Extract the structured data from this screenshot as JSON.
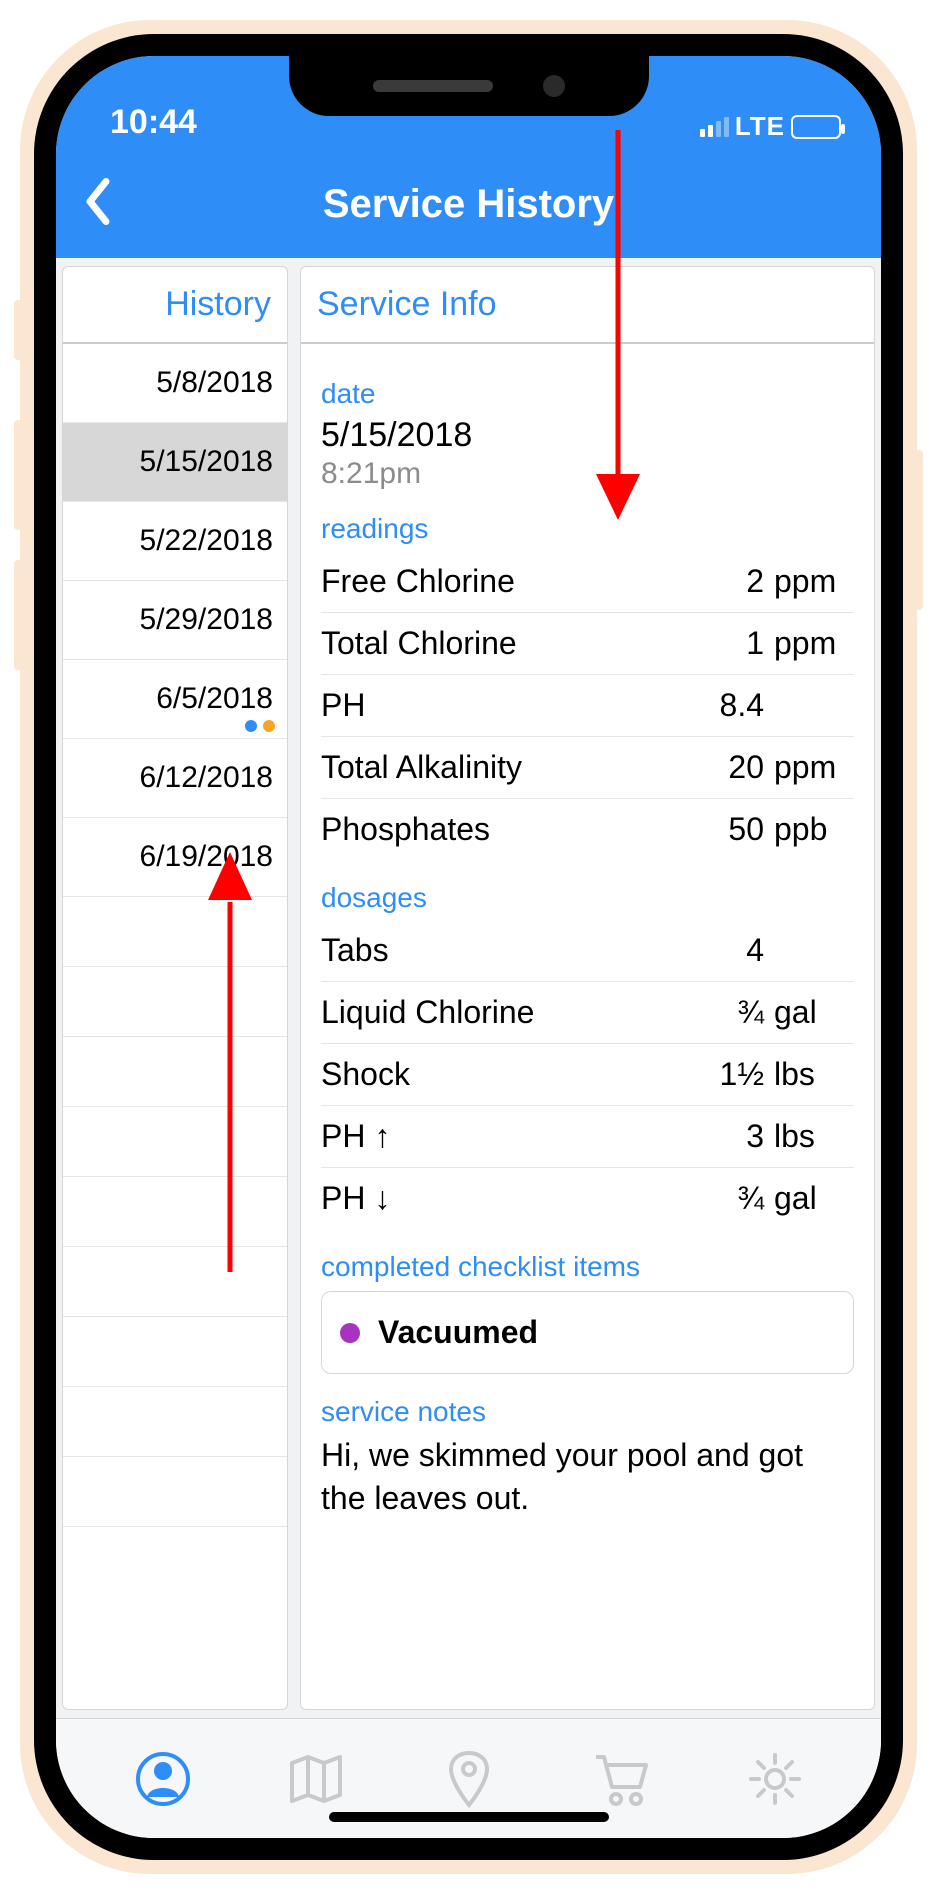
{
  "status": {
    "time": "10:44",
    "carrier": "LTE"
  },
  "header": {
    "title": "Service History"
  },
  "sidebar": {
    "header": "History",
    "items": [
      {
        "label": "5/8/2018",
        "selected": false,
        "dots": []
      },
      {
        "label": "5/15/2018",
        "selected": true,
        "dots": []
      },
      {
        "label": "5/22/2018",
        "selected": false,
        "dots": []
      },
      {
        "label": "5/29/2018",
        "selected": false,
        "dots": []
      },
      {
        "label": "6/5/2018",
        "selected": false,
        "dots": [
          "#2e8df6",
          "#f5a623"
        ]
      },
      {
        "label": "6/12/2018",
        "selected": false,
        "dots": []
      },
      {
        "label": "6/19/2018",
        "selected": false,
        "dots": []
      }
    ]
  },
  "info": {
    "header": "Service Info",
    "date_label": "date",
    "date": "5/15/2018",
    "time": "8:21pm",
    "readings_label": "readings",
    "readings": [
      {
        "label": "Free Chlorine",
        "value": "2",
        "unit": "ppm"
      },
      {
        "label": "Total Chlorine",
        "value": "1",
        "unit": "ppm"
      },
      {
        "label": "PH",
        "value": "8.4",
        "unit": ""
      },
      {
        "label": "Total Alkalinity",
        "value": "20",
        "unit": "ppm"
      },
      {
        "label": "Phosphates",
        "value": "50",
        "unit": "ppb"
      }
    ],
    "dosages_label": "dosages",
    "dosages": [
      {
        "label": "Tabs",
        "value": "4",
        "unit": ""
      },
      {
        "label": "Liquid Chlorine",
        "value": "¾",
        "unit": "gal"
      },
      {
        "label": "Shock",
        "value": "1½",
        "unit": "lbs"
      },
      {
        "label": "PH ↑",
        "value": "3",
        "unit": "lbs"
      },
      {
        "label": "PH ↓",
        "value": "¾",
        "unit": "gal"
      }
    ],
    "checklist_label": "completed checklist items",
    "checklist": [
      {
        "label": "Vacuumed",
        "color": "#a832c2"
      }
    ],
    "notes_label": "service notes",
    "notes": "Hi, we skimmed your pool and got the leaves out."
  },
  "tabs": {
    "profile": "profile",
    "map": "map",
    "pin": "location",
    "cart": "cart",
    "settings": "settings"
  }
}
